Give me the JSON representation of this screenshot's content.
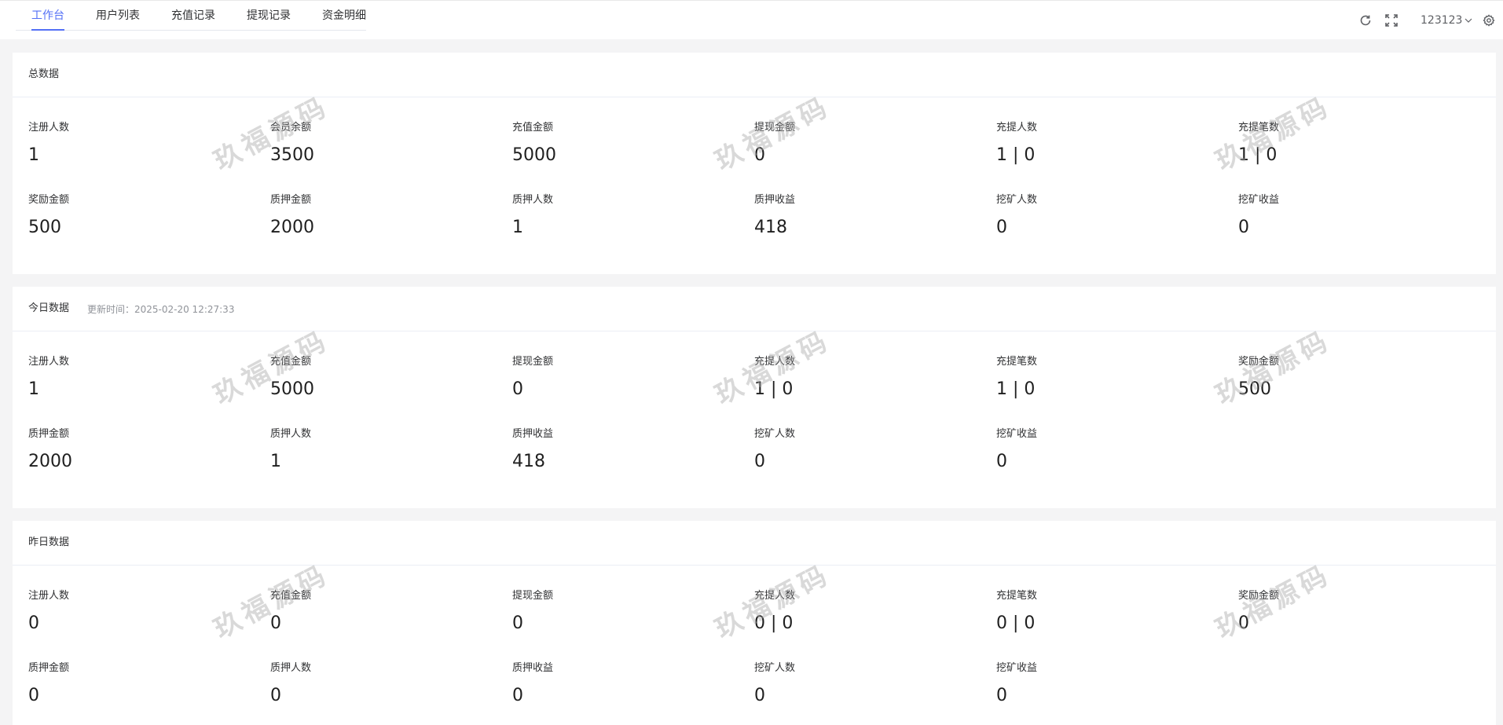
{
  "tabs": [
    {
      "label": "工作台",
      "active": true
    },
    {
      "label": "用户列表",
      "active": false
    },
    {
      "label": "充值记录",
      "active": false
    },
    {
      "label": "提现记录",
      "active": false
    },
    {
      "label": "资金明细",
      "active": false
    }
  ],
  "toolbar": {
    "refresh_icon": "refresh-icon",
    "fullscreen_icon": "fullscreen-icon",
    "username": "123123",
    "settings_icon": "gear-icon"
  },
  "accent_color": "#5470f6",
  "watermark_text": "玖福源码",
  "total": {
    "title": "总数据",
    "stats": [
      {
        "label": "注册人数",
        "value": "1"
      },
      {
        "label": "会员余额",
        "value": "3500"
      },
      {
        "label": "充值金额",
        "value": "5000"
      },
      {
        "label": "提现金额",
        "value": "0"
      },
      {
        "label": "充提人数",
        "value": "1 | 0"
      },
      {
        "label": "充提笔数",
        "value": "1 | 0"
      },
      {
        "label": "奖励金额",
        "value": "500"
      },
      {
        "label": "质押金额",
        "value": "2000"
      },
      {
        "label": "质押人数",
        "value": "1"
      },
      {
        "label": "质押收益",
        "value": "418"
      },
      {
        "label": "挖矿人数",
        "value": "0"
      },
      {
        "label": "挖矿收益",
        "value": "0"
      }
    ]
  },
  "today": {
    "title": "今日数据",
    "updated": "更新时间：2025-02-20 12:27:33",
    "stats": [
      {
        "label": "注册人数",
        "value": "1"
      },
      {
        "label": "充值金额",
        "value": "5000"
      },
      {
        "label": "提现金额",
        "value": "0"
      },
      {
        "label": "充提人数",
        "value": "1 | 0"
      },
      {
        "label": "充提笔数",
        "value": "1 | 0"
      },
      {
        "label": "奖励金额",
        "value": "500"
      },
      {
        "label": "质押金额",
        "value": "2000"
      },
      {
        "label": "质押人数",
        "value": "1"
      },
      {
        "label": "质押收益",
        "value": "418"
      },
      {
        "label": "挖矿人数",
        "value": "0"
      },
      {
        "label": "挖矿收益",
        "value": "0"
      }
    ]
  },
  "yesterday": {
    "title": "昨日数据",
    "stats": [
      {
        "label": "注册人数",
        "value": "0"
      },
      {
        "label": "充值金额",
        "value": "0"
      },
      {
        "label": "提现金额",
        "value": "0"
      },
      {
        "label": "充提人数",
        "value": "0 | 0"
      },
      {
        "label": "充提笔数",
        "value": "0 | 0"
      },
      {
        "label": "奖励金额",
        "value": "0"
      },
      {
        "label": "质押金额",
        "value": "0"
      },
      {
        "label": "质押人数",
        "value": "0"
      },
      {
        "label": "质押收益",
        "value": "0"
      },
      {
        "label": "挖矿人数",
        "value": "0"
      },
      {
        "label": "挖矿收益",
        "value": "0"
      }
    ]
  }
}
